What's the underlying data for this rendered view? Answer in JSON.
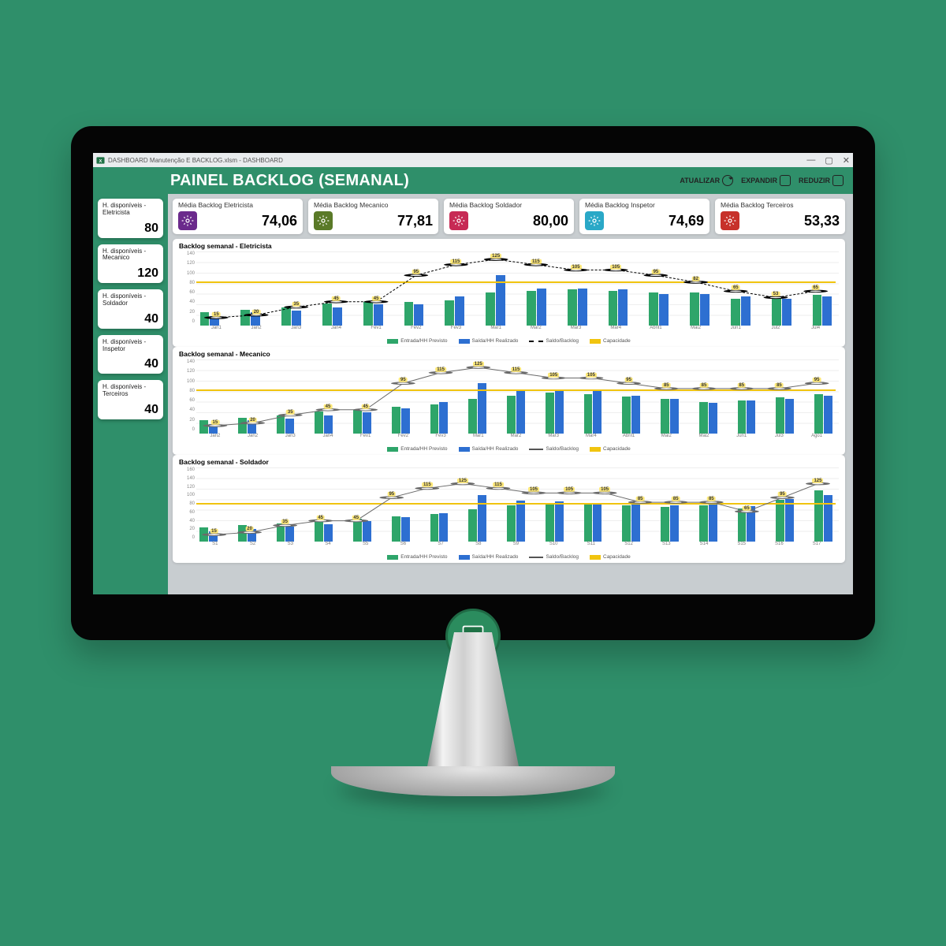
{
  "window": {
    "title": "DASHBOARD Manutenção E BACKLOG.xlsm - DASHBOARD",
    "controls": {
      "min": "—",
      "max": "▢",
      "close": "✕"
    }
  },
  "header": {
    "title": "PAINEL BACKLOG (SEMANAL)",
    "actions": {
      "refresh": "ATUALIZAR",
      "expand": "EXPANDIR",
      "reduce": "REDUZIR"
    }
  },
  "sidebar": [
    {
      "label": "H. disponíveis - Eletricista",
      "value": "80"
    },
    {
      "label": "H. disponíveis - Mecanico",
      "value": "120"
    },
    {
      "label": "H. disponíveis - Soldador",
      "value": "40"
    },
    {
      "label": "H. disponíveis - Inspetor",
      "value": "40"
    },
    {
      "label": "H. disponíveis - Terceiros",
      "value": "40"
    }
  ],
  "kpis": [
    {
      "label": "Média Backlog Eletricista",
      "value": "74,06",
      "color": "#6b2a8c"
    },
    {
      "label": "Média Backlog Mecanico",
      "value": "77,81",
      "color": "#5a7a28"
    },
    {
      "label": "Média Backlog Soldador",
      "value": "80,00",
      "color": "#c72a55"
    },
    {
      "label": "Média Backlog Inspetor",
      "value": "74,69",
      "color": "#2aa8c7"
    },
    {
      "label": "Média Backlog Terceiros",
      "value": "53,33",
      "color": "#c7312a"
    }
  ],
  "legend": {
    "a": "Entrada/HH Previsto",
    "b": "Saída/HH Realizado",
    "c": "Saldo/Backlog",
    "d": "Capacidade"
  },
  "chart_data": [
    {
      "id": "eletricista",
      "title": "Backlog semanal - Eletricista",
      "type": "bar+line",
      "categories": [
        "Jan1",
        "Jan2",
        "Jan3",
        "Jan4",
        "Fev1",
        "Fev2",
        "Fev3",
        "Mar1",
        "Mar2",
        "Mar3",
        "Mar4",
        "Abril1",
        "Mai2",
        "Jun1",
        "Jul2",
        "Jul4"
      ],
      "series": [
        {
          "name": "Entrada/HH Previsto",
          "color": "#2ea56a",
          "values": [
            25,
            30,
            35,
            42,
            45,
            45,
            48,
            62,
            65,
            68,
            65,
            62,
            62,
            50,
            55,
            58
          ]
        },
        {
          "name": "Saída/HH Realizado",
          "color": "#2d6fd1",
          "values": [
            18,
            25,
            28,
            35,
            40,
            40,
            55,
            95,
            70,
            70,
            68,
            60,
            60,
            55,
            50,
            55
          ]
        }
      ],
      "line": {
        "name": "Saldo/Backlog",
        "style": "dash",
        "color": "#000000",
        "values": [
          15,
          20,
          35,
          45,
          45,
          95,
          115,
          125,
          115,
          105,
          105,
          95,
          82,
          65,
          53,
          65
        ],
        "labels": [
          15,
          20,
          35,
          45,
          45,
          95,
          115,
          125,
          115,
          105,
          105,
          95,
          82,
          65,
          53,
          65
        ]
      },
      "capacity": 80,
      "ylim": [
        0,
        140
      ],
      "yticks": [
        0,
        20,
        40,
        60,
        80,
        100,
        120,
        140
      ]
    },
    {
      "id": "mecanico",
      "title": "Backlog semanal - Mecanico",
      "type": "bar+line",
      "categories": [
        "Jan2",
        "Jan2",
        "Jan3",
        "Jan4",
        "Fev1",
        "Fev2",
        "Fev3",
        "Mar1",
        "Mar2",
        "Mar3",
        "Mar4",
        "Abril1",
        "Mai2",
        "Mai2",
        "Jun1",
        "Jul3",
        "Ago1"
      ],
      "series": [
        {
          "name": "Entrada/HH Previsto",
          "color": "#2ea56a",
          "values": [
            25,
            30,
            35,
            42,
            45,
            50,
            55,
            65,
            72,
            78,
            75,
            70,
            65,
            60,
            63,
            68,
            75
          ]
        },
        {
          "name": "Saída/HH Realizado",
          "color": "#2d6fd1",
          "values": [
            18,
            25,
            28,
            35,
            40,
            48,
            60,
            95,
            80,
            82,
            80,
            72,
            65,
            58,
            62,
            66,
            72
          ]
        }
      ],
      "line": {
        "name": "Saldo/Backlog",
        "style": "solid",
        "color": "#6a6a6a",
        "values": [
          15,
          20,
          35,
          45,
          45,
          95,
          115,
          125,
          115,
          105,
          105,
          95,
          85,
          85,
          85,
          85,
          95
        ],
        "labels": [
          15,
          20,
          35,
          45,
          45,
          95,
          115,
          125,
          115,
          105,
          105,
          95,
          85,
          85,
          85,
          85,
          95
        ]
      },
      "capacity": 80,
      "ylim": [
        0,
        140
      ],
      "yticks": [
        0,
        20,
        40,
        60,
        80,
        100,
        120,
        140
      ]
    },
    {
      "id": "soldador",
      "title": "Backlog semanal - Soldador",
      "type": "bar+line",
      "categories": [
        "S1",
        "S2",
        "S3",
        "S4",
        "S5",
        "S6",
        "S7",
        "S8",
        "S9",
        "S10",
        "S11",
        "S12",
        "S13",
        "S14",
        "S15",
        "S16",
        "S17"
      ],
      "series": [
        {
          "name": "Entrada/HH Previsto",
          "color": "#2ea56a",
          "values": [
            30,
            35,
            40,
            45,
            50,
            55,
            60,
            70,
            78,
            82,
            80,
            78,
            75,
            78,
            72,
            90,
            110
          ]
        },
        {
          "name": "Saída/HH Realizado",
          "color": "#2d6fd1",
          "values": [
            22,
            28,
            32,
            38,
            45,
            52,
            62,
            100,
            88,
            86,
            84,
            80,
            78,
            80,
            76,
            92,
            100
          ]
        }
      ],
      "line": {
        "name": "Saldo/Backlog",
        "style": "solid",
        "color": "#6a6a6a",
        "values": [
          15,
          20,
          35,
          45,
          45,
          95,
          115,
          125,
          115,
          105,
          105,
          105,
          85,
          85,
          85,
          65,
          95,
          125
        ],
        "labels": [
          15,
          20,
          35,
          45,
          45,
          95,
          115,
          125,
          115,
          105,
          105,
          105,
          85,
          85,
          85,
          65,
          95,
          125
        ]
      },
      "capacity": 80,
      "ylim": [
        0,
        160
      ],
      "yticks": [
        0,
        20,
        40,
        60,
        80,
        100,
        120,
        140,
        160
      ]
    }
  ]
}
